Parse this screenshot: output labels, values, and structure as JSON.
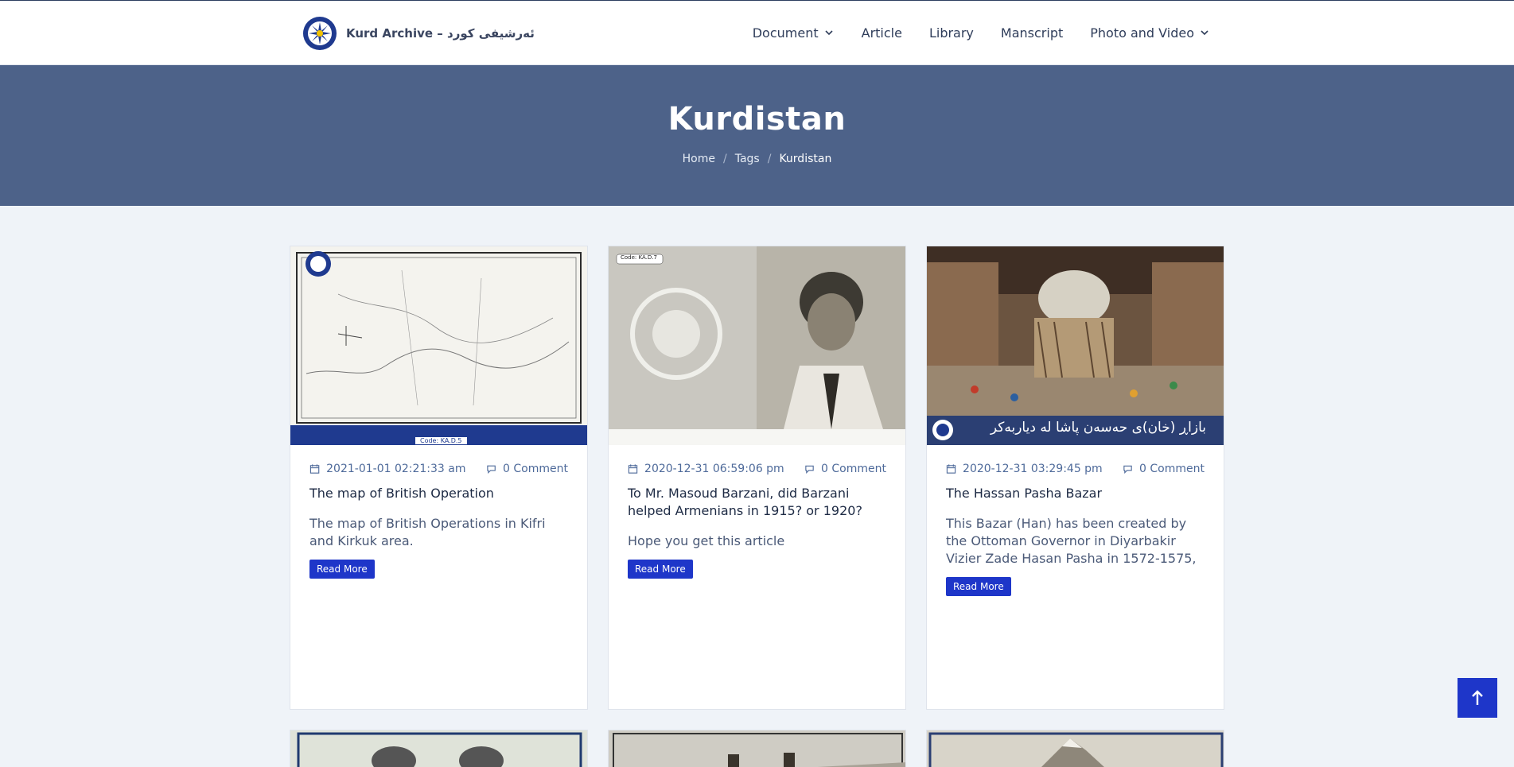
{
  "header": {
    "brand": "Kurd Archive – ئەرشیفی کورد",
    "nav": [
      {
        "label": "Document",
        "dropdown": true
      },
      {
        "label": "Article",
        "dropdown": false
      },
      {
        "label": "Library",
        "dropdown": false
      },
      {
        "label": "Manscript",
        "dropdown": false
      },
      {
        "label": "Photo and Video",
        "dropdown": true
      }
    ]
  },
  "banner": {
    "title": "Kurdistan",
    "breadcrumb": [
      "Home",
      "Tags",
      "Kurdistan"
    ]
  },
  "cards": [
    {
      "image_caption": "Code: KA.D.5",
      "date": "2021-01-01 02:21:33 am",
      "comments": "0 Comment",
      "title": "The map of British Operation",
      "excerpt": "The map of British Operations in Kifri and Kirkuk area.",
      "button": "Read More"
    },
    {
      "image_caption": "Code: KA.D.7",
      "date": "2020-12-31 06:59:06 pm",
      "comments": "0 Comment",
      "title": "To Mr. Masoud Barzani, did Barzani helped Armenians in 1915? or 1920?",
      "excerpt": "Hope you get this article",
      "button": "Read More"
    },
    {
      "image_caption": "بازاڕ (خان)ی حەسەن پاشا لە دیاربەکر",
      "date": "2020-12-31 03:29:45 pm",
      "comments": "0 Comment",
      "title": "The Hassan Pasha Bazar",
      "excerpt": "This Bazar (Han) has been created by the Ottoman Governor in Diyarbakir Vizier Zade Hasan Pasha in 1572-1575,",
      "button": "Read More"
    }
  ],
  "colors": {
    "banner": "#4d6289",
    "button": "#1e36c9",
    "page_bg": "#eff3f8"
  },
  "icons": {
    "date": "calendar-icon",
    "comments": "comment-icon",
    "scroll_top": "arrow-up-icon"
  }
}
